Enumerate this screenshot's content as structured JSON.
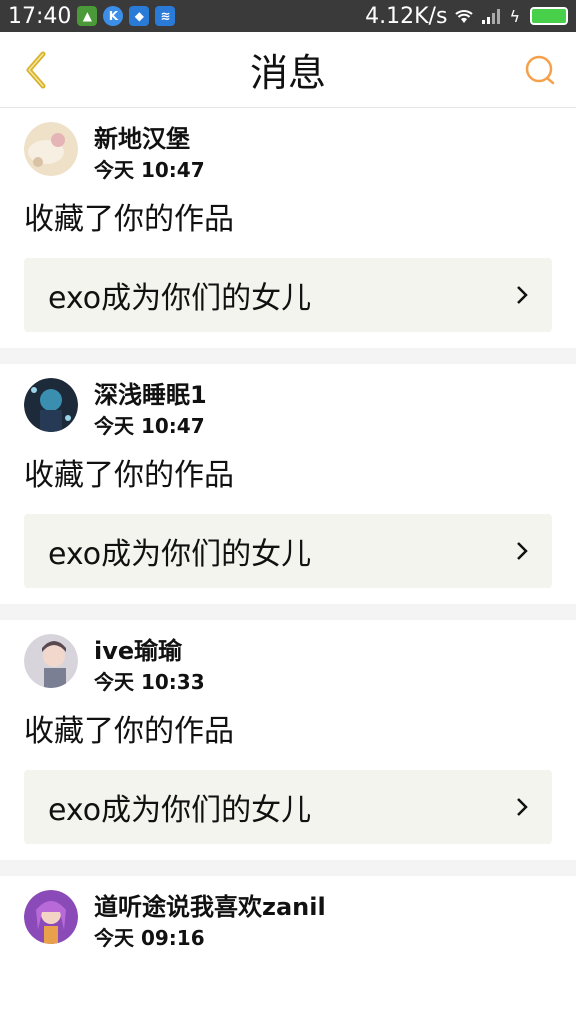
{
  "status_bar": {
    "time": "17:40",
    "speed": "4.12K/s"
  },
  "header": {
    "title": "消息"
  },
  "colors": {
    "accent": "#f5a04a",
    "back_icon": "#d9b12a",
    "box_bg": "#f4f4ee"
  },
  "messages": [
    {
      "user": "新地汉堡",
      "time": "今天 10:47",
      "action": "收藏了你的作品",
      "work": "exo成为你们的女儿"
    },
    {
      "user": "深浅睡眠1",
      "time": "今天 10:47",
      "action": "收藏了你的作品",
      "work": "exo成为你们的女儿"
    },
    {
      "user": "ive瑜瑜",
      "time": "今天 10:33",
      "action": "收藏了你的作品",
      "work": "exo成为你们的女儿"
    },
    {
      "user": "道听途说我喜欢zanil",
      "time": "今天 09:16"
    }
  ]
}
